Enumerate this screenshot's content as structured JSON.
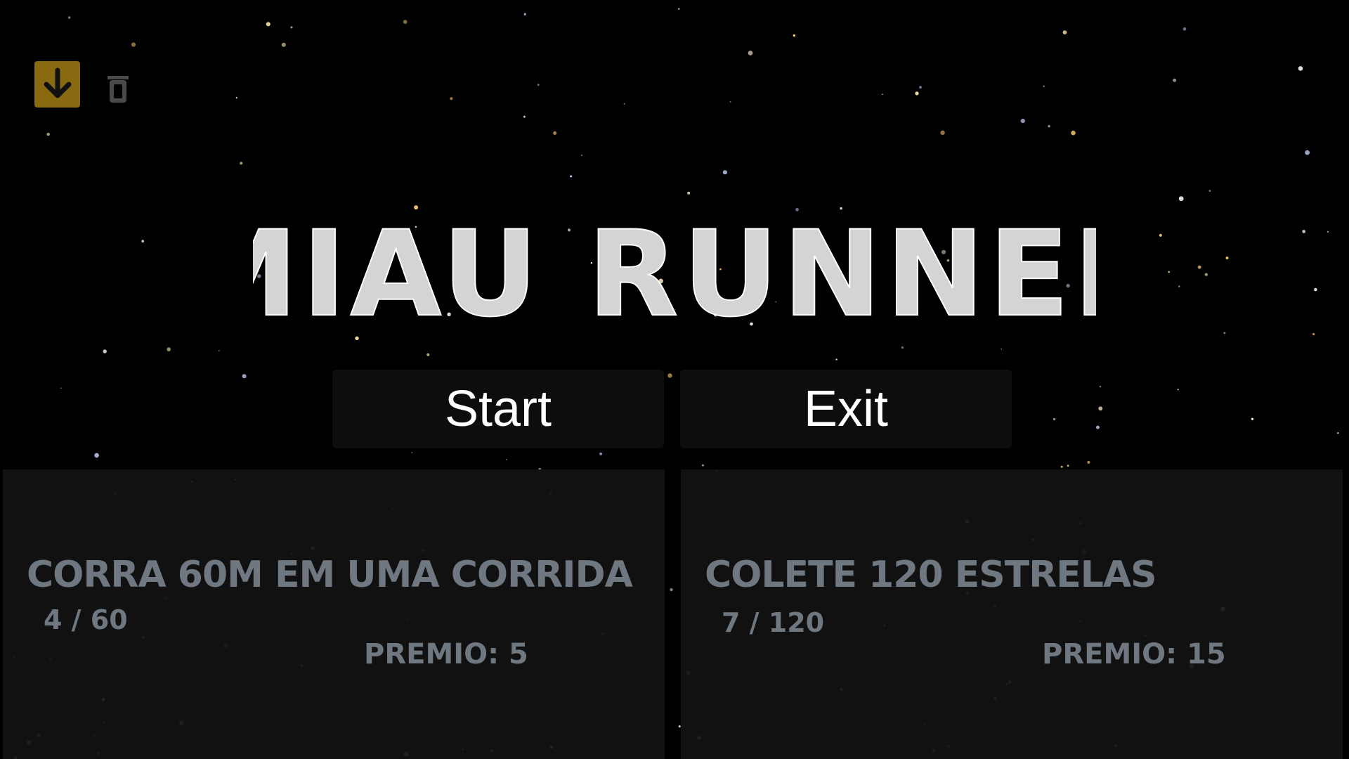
{
  "game": {
    "title": "MIAU RUNNER"
  },
  "hud": {
    "download_icon": "download-arrow-icon",
    "trash_icon": "trash-icon",
    "download_color": "#8a6a10"
  },
  "menu": {
    "start_label": "Start",
    "exit_label": "Exit"
  },
  "missions": [
    {
      "title": "CORRA 60M EM UMA CORRIDA",
      "progress": "4 / 60",
      "reward": "PREMIO: 5"
    },
    {
      "title": "COLETE 120 ESTRELAS",
      "progress": "7 / 120",
      "reward": "PREMIO: 15"
    }
  ],
  "colors": {
    "background": "#000000",
    "title": "#d4d4d4",
    "button_bg": "#0d0d0d",
    "mission_text": "#6f7880"
  }
}
